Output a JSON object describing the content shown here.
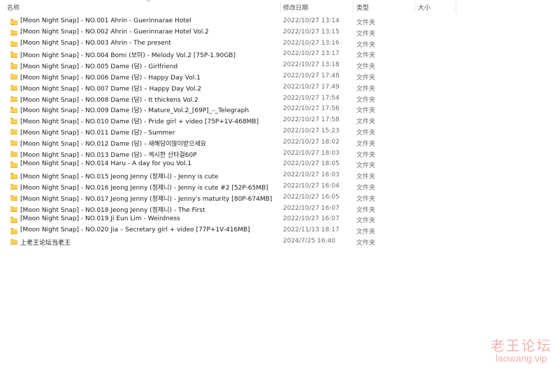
{
  "columns": {
    "name": "名称",
    "date": "修改日期",
    "type": "类型",
    "size": "大小"
  },
  "rows": [
    {
      "name": "[Moon Night Snap] - NO.001 Ahrin - Guerinnarae Hotel",
      "date": "2022/10/27 13:14",
      "type": "文件夹"
    },
    {
      "name": "[Moon Night Snap] - NO.002 Ahrin - Guerinnarae Hotel Vol.2",
      "date": "2022/10/27 13:15",
      "type": "文件夹"
    },
    {
      "name": "[Moon Night Snap] - NO.003 Ahrin - The present",
      "date": "2022/10/27 13:16",
      "type": "文件夹"
    },
    {
      "name": "[Moon Night Snap] - NO.004 Bomi (보미) - Melody Vol.2 [75P-1.90GB]",
      "date": "2022/10/27 13:17",
      "type": "文件夹"
    },
    {
      "name": "[Moon Night Snap] - NO.005 Dame (담) - Girlfriend",
      "date": "2022/10/27 13:18",
      "type": "文件夹"
    },
    {
      "name": "[Moon Night Snap] - NO.006 Dame (담) - Happy Day Vol.1",
      "date": "2022/10/27 17:48",
      "type": "文件夹"
    },
    {
      "name": "[Moon Night Snap] - NO.007 Dame (담) – Happy Day Vol.2",
      "date": "2022/10/27 17:49",
      "type": "文件夹"
    },
    {
      "name": "[Moon Night Snap] - NO.008 Dame (담) - It thickens Vol.2",
      "date": "2022/10/27 17:54",
      "type": "文件夹"
    },
    {
      "name": "[Moon Night Snap] - NO.009 Dame (담) - Mature_Vol.2_[69P]_–_Telegraph",
      "date": "2022/10/27 17:56",
      "type": "文件夹"
    },
    {
      "name": "[Moon Night Snap] - NO.010 Dame (담) - Pride girl + video [75P+1V-468MB]",
      "date": "2022/10/27 17:58",
      "type": "文件夹"
    },
    {
      "name": "[Moon Night Snap] - NO.011 Dame (담) - Summer",
      "date": "2022/10/27 15:23",
      "type": "文件夹"
    },
    {
      "name": "[Moon Night Snap] - NO.012 Dame (담) - 새해담이많이받으세요",
      "date": "2022/10/27 18:02",
      "type": "文件夹"
    },
    {
      "name": "[Moon Night Snap] - NO.013 Dame (담) - 섹시한 산타걸60P",
      "date": "2022/10/27 18:03",
      "type": "文件夹"
    },
    {
      "name": "[Moon Night Snap] - NO.014 Haru - A day for you Vol.1",
      "date": "2022/10/27 18:05",
      "type": "文件夹"
    },
    {
      "name": "[Moon Night Snap] - NO.015 Jeong Jenny (정제니) - Jenny is cute",
      "date": "2022/10/27 16:03",
      "type": "文件夹"
    },
    {
      "name": "[Moon Night Snap] - NO.016 Jeong Jenny (정제니) - Jenny is cute #2 [52P-65MB]",
      "date": "2022/10/27 16:04",
      "type": "文件夹"
    },
    {
      "name": "[Moon Night Snap] - NO.017 Jeong Jenny (정제니) - Jenny's maturity [80P-674MB]",
      "date": "2022/10/27 16:05",
      "type": "文件夹"
    },
    {
      "name": "[Moon Night Snap] - NO.018 Jeong Jenny (정제니) - The First",
      "date": "2022/10/27 16:07",
      "type": "文件夹"
    },
    {
      "name": "[Moon Night Snap] - NO.019 Ji Eun Lim - Weirdness",
      "date": "2022/10/27 16:07",
      "type": "文件夹"
    },
    {
      "name": "[Moon Night Snap] - NO.020 Jia – Secretary girl + video [77P+1V-416MB]",
      "date": "2022/11/13 18:17",
      "type": "文件夹"
    },
    {
      "name": "上老王论坛当老王",
      "date": "2024/7/25 16:40",
      "type": "文件夹"
    }
  ],
  "watermark": {
    "text_cn": "老王论坛",
    "text_en": "laowang.vip"
  },
  "colors": {
    "folder": "#f8cf5a",
    "watermark": "#f0b1b4"
  }
}
